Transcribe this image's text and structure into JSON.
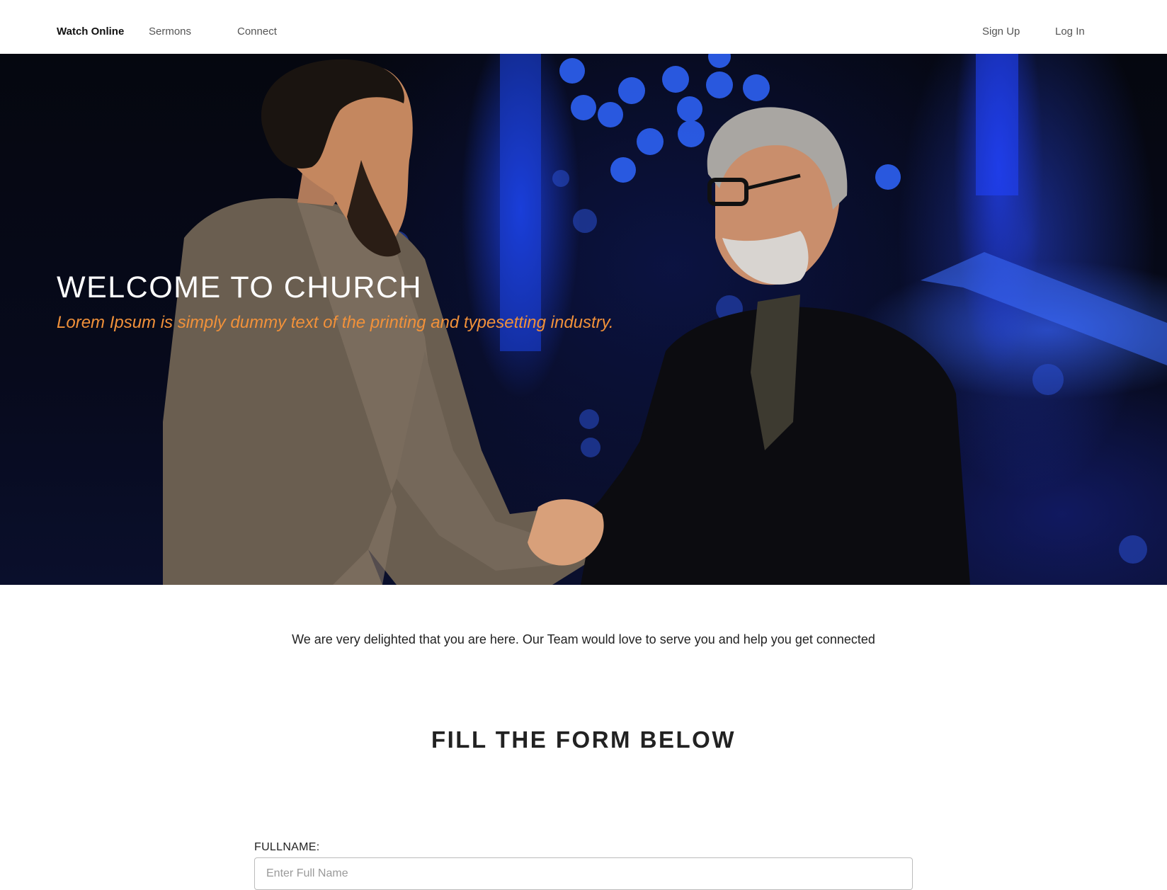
{
  "nav": {
    "links": [
      {
        "label": "Watch Online"
      },
      {
        "label": "Sermons"
      },
      {
        "label": "Connect"
      }
    ],
    "signup_label": "Sign Up",
    "login_label": "Log In"
  },
  "hero": {
    "title": "WELCOME TO CHURCH",
    "subtitle": "Lorem Ipsum is simply dummy text of the printing and typesetting industry.",
    "accent_color": "#f1913a"
  },
  "intro": {
    "text": "We are very delighted that you are here. Our Team would love to serve you and help you get connected"
  },
  "form": {
    "heading": "FILL THE FORM BELOW",
    "fields": [
      {
        "label": "FULLNAME:",
        "placeholder": "Enter Full Name",
        "value": ""
      }
    ]
  }
}
